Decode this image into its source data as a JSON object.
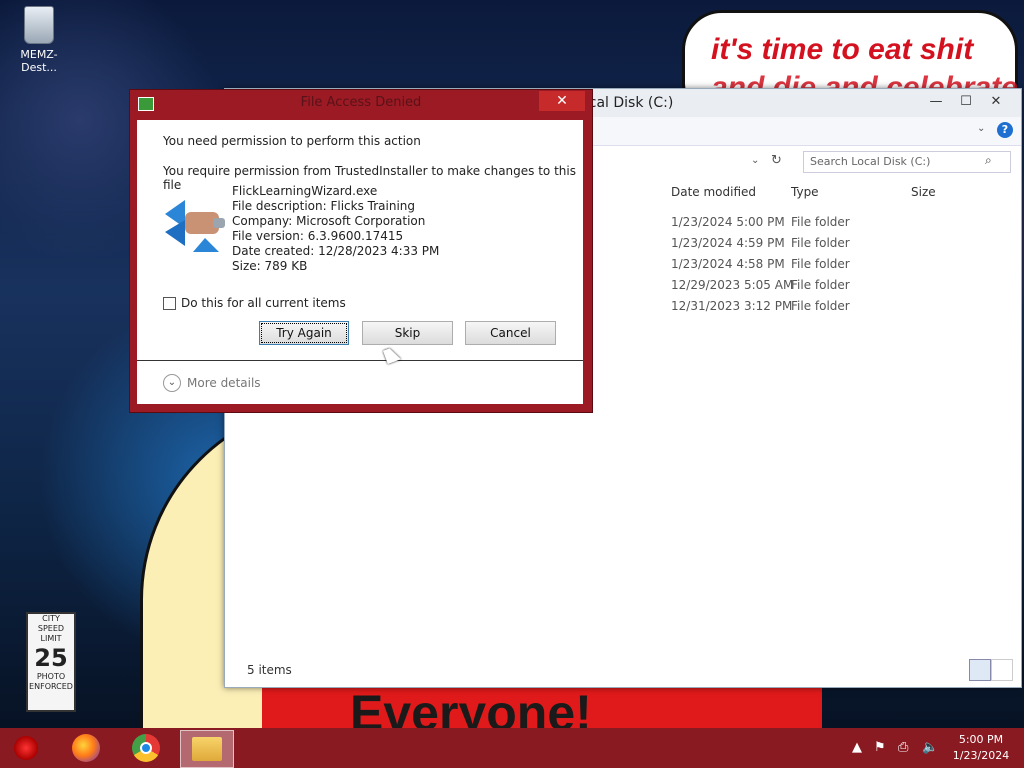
{
  "desktop": {
    "recycle_label": "MEMZ-Dest...",
    "speech_line1": "it's time to eat shit",
    "speech_line2": "and die and celebrate",
    "banner_text": "Everyone!",
    "sign_top": "CITY SPEED LIMIT",
    "sign_num": "25",
    "sign_bottom": "PHOTO ENFORCED"
  },
  "explorer": {
    "title": "Local Disk (C:)",
    "search_placeholder": "Search Local Disk (C:)",
    "columns": {
      "date": "Date modified",
      "type": "Type",
      "size": "Size"
    },
    "rows": [
      {
        "date": "1/23/2024 5:00 PM",
        "type": "File folder"
      },
      {
        "date": "1/23/2024 4:59 PM",
        "type": "File folder"
      },
      {
        "date": "1/23/2024 4:58 PM",
        "type": "File folder"
      },
      {
        "date": "12/29/2023 5:05 AM",
        "type": "File folder"
      },
      {
        "date": "12/31/2023 3:12 PM",
        "type": "File folder"
      }
    ],
    "status": "5 items",
    "minimize": "—",
    "maximize": "☐",
    "close": "✕",
    "help": "?"
  },
  "dialog": {
    "title": "File Access Denied",
    "close": "✕",
    "heading": "You need permission to perform this action",
    "message": "You require permission from TrustedInstaller to make changes to this file",
    "file": {
      "name": "FlickLearningWizard.exe",
      "description": "File description: Flicks Training",
      "company": "Company: Microsoft Corporation",
      "version": "File version: 6.3.9600.17415",
      "created": "Date created: 12/28/2023 4:33 PM",
      "size": "Size: 789 KB"
    },
    "checkbox_label": "Do this for all current items",
    "buttons": {
      "try_again": "Try Again",
      "skip": "Skip",
      "cancel": "Cancel"
    },
    "more_details": "More details"
  },
  "taskbar": {
    "time": "5:00 PM",
    "date": "1/23/2024"
  }
}
